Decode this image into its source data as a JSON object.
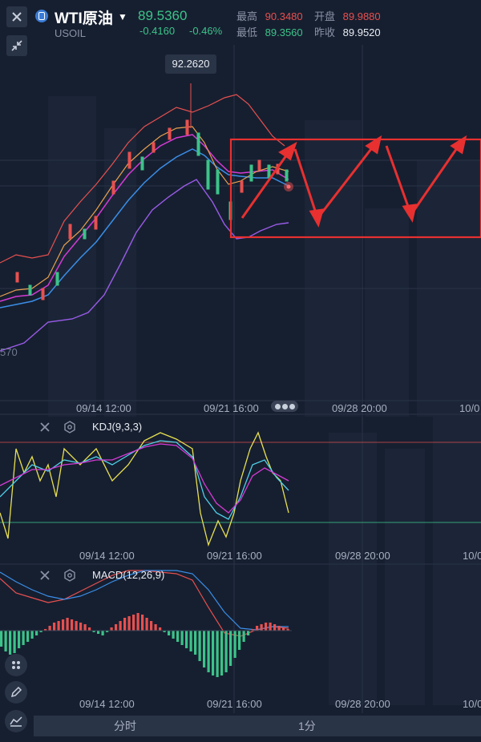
{
  "header": {
    "title": "WTI原油",
    "symbol": "USOIL",
    "last_price": "89.5360",
    "change": "-0.4160",
    "change_pct": "-0.46%",
    "stats": [
      {
        "label": "最高",
        "value": "90.3480",
        "color": "#e8504f"
      },
      {
        "label": "开盘",
        "value": "89.9880",
        "color": "#e8504f"
      },
      {
        "label": "最低",
        "value": "89.3560",
        "color": "#3cc389"
      },
      {
        "label": "昨收",
        "value": "89.9520",
        "color": "#e8ecf2"
      }
    ]
  },
  "main_chart": {
    "high_marker": "92.2620",
    "low_label_partial": "570",
    "x_ticks": [
      "09/14 12:00",
      "09/21 16:00",
      "09/28 20:00",
      "10/0"
    ]
  },
  "kdj": {
    "label": "KDJ(9,3,3)",
    "x_ticks": [
      "09/14 12:00",
      "09/21 16:00",
      "09/28 20:00",
      "10/0"
    ]
  },
  "macd": {
    "label": "MACD(12,26,9)",
    "x_ticks": [
      "09/14 12:00",
      "09/21 16:00",
      "09/28 20:00",
      "10/0"
    ]
  },
  "tabs": [
    "分时",
    "1分"
  ],
  "colors": {
    "up": "#e8504f",
    "down": "#3cc389",
    "annotation": "#e83030",
    "ma_orange": "#e8a04f",
    "ma_magenta": "#d63ad6",
    "ma_blue": "#3a8ee8",
    "bb_purple": "#9a5be8"
  },
  "icons": [
    "close-icon",
    "shrink-icon",
    "settings-icon",
    "pen-icon",
    "indicator-icon"
  ]
}
